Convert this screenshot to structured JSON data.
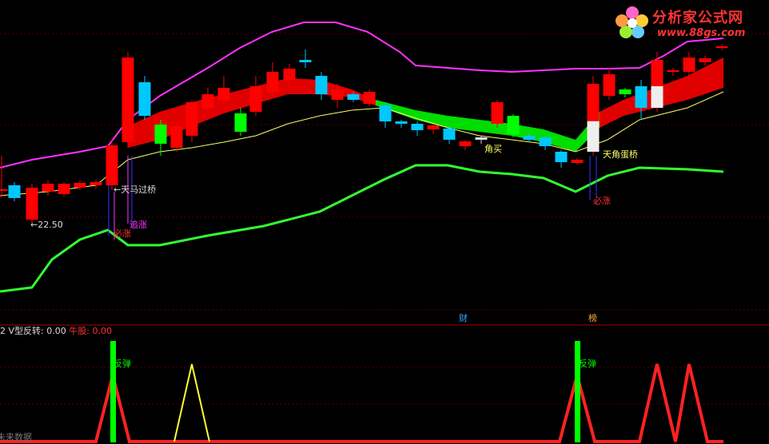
{
  "logo": {
    "title": "分析家公式网",
    "url": "www.88gs.com"
  },
  "price_labels": {
    "low_marker": "←22.50",
    "tianma": "←天马过桥",
    "bizhang_1": "必涨",
    "zhuizhang": "追涨",
    "jiaomai": "角买",
    "tianjiao": "天角蛋桥",
    "bizhang_2": "必涨"
  },
  "markers": {
    "cai": "财",
    "bang": "榜"
  },
  "sub_panel": {
    "prefix": "2",
    "v_label": "V型反转:",
    "v_value": "0.00",
    "bull_label": "牛股:",
    "bull_value": "0.00",
    "rebound_1": "反弹",
    "rebound_2": "反弹",
    "footer": "未来数据"
  },
  "colors": {
    "up": "#ff0000",
    "down_blue": "#00c8ff",
    "down_green": "#00ff00",
    "upper_band": "#ff33ff",
    "lower_band": "#33ff33",
    "ma_yellow": "#ffff66",
    "divider": "#aa0000"
  }
}
